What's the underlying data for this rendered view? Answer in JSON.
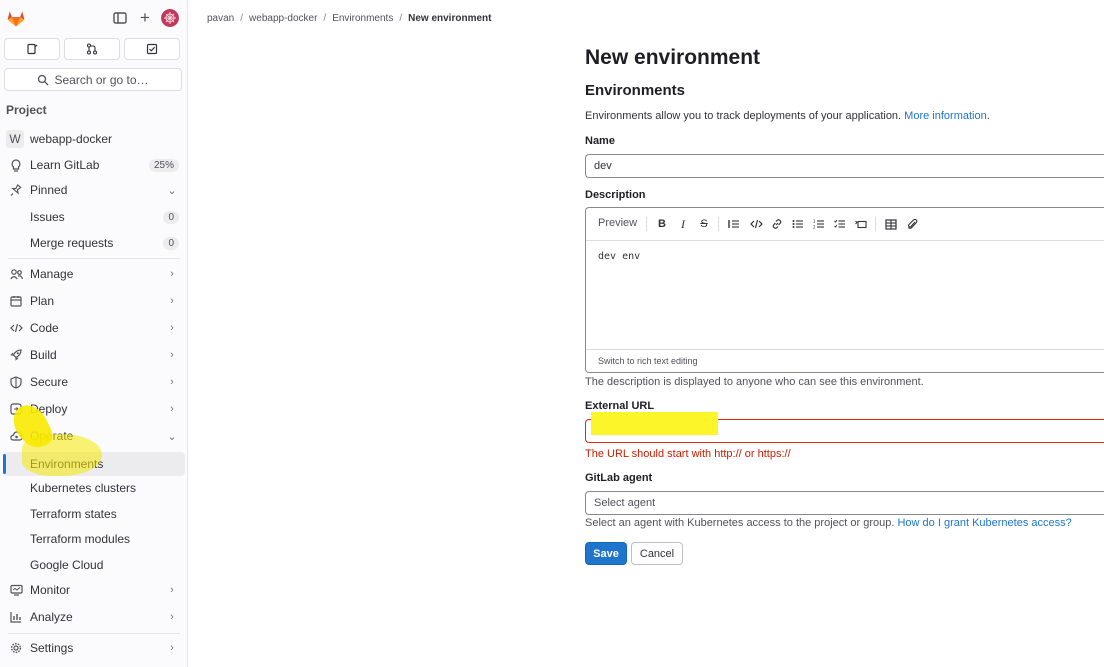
{
  "sidebar": {
    "search_label": "Search or go to…",
    "section_label": "Project",
    "project_initial": "W",
    "project_name": "webapp-docker",
    "items": [
      {
        "label": "Learn GitLab",
        "badge": "25%"
      },
      {
        "label": "Pinned"
      },
      {
        "label": "Issues",
        "badge": "0"
      },
      {
        "label": "Merge requests",
        "badge": "0"
      },
      {
        "label": "Manage"
      },
      {
        "label": "Plan"
      },
      {
        "label": "Code"
      },
      {
        "label": "Build"
      },
      {
        "label": "Secure"
      },
      {
        "label": "Deploy"
      },
      {
        "label": "Operate"
      },
      {
        "label": "Environments"
      },
      {
        "label": "Kubernetes clusters"
      },
      {
        "label": "Terraform states"
      },
      {
        "label": "Terraform modules"
      },
      {
        "label": "Google Cloud"
      },
      {
        "label": "Monitor"
      },
      {
        "label": "Analyze"
      },
      {
        "label": "Settings"
      }
    ]
  },
  "breadcrumb": [
    "pavan",
    "webapp-docker",
    "Environments",
    "New environment"
  ],
  "page": {
    "title": "New environment",
    "subtitle": "Environments",
    "intro_text": "Environments allow you to track deployments of your application.",
    "intro_link": "More information",
    "name_label": "Name",
    "name_value": "dev",
    "description_label": "Description",
    "preview_tab": "Preview",
    "description_value": "dev env",
    "switch_editor": "Switch to rich text editing",
    "description_help": "The description is displayed to anyone who can see this environment.",
    "url_label": "External URL",
    "url_value": "",
    "url_error": "The URL should start with http:// or https://",
    "agent_label": "GitLab agent",
    "agent_placeholder": "Select agent",
    "agent_help": "Select an agent with Kubernetes access to the project or group.",
    "agent_help_link": "How do I grant Kubernetes access?",
    "save_label": "Save",
    "cancel_label": "Cancel"
  },
  "colors": {
    "accent": "#1f75cb",
    "error": "#dd2b0e",
    "highlight": "#fcf52a"
  }
}
